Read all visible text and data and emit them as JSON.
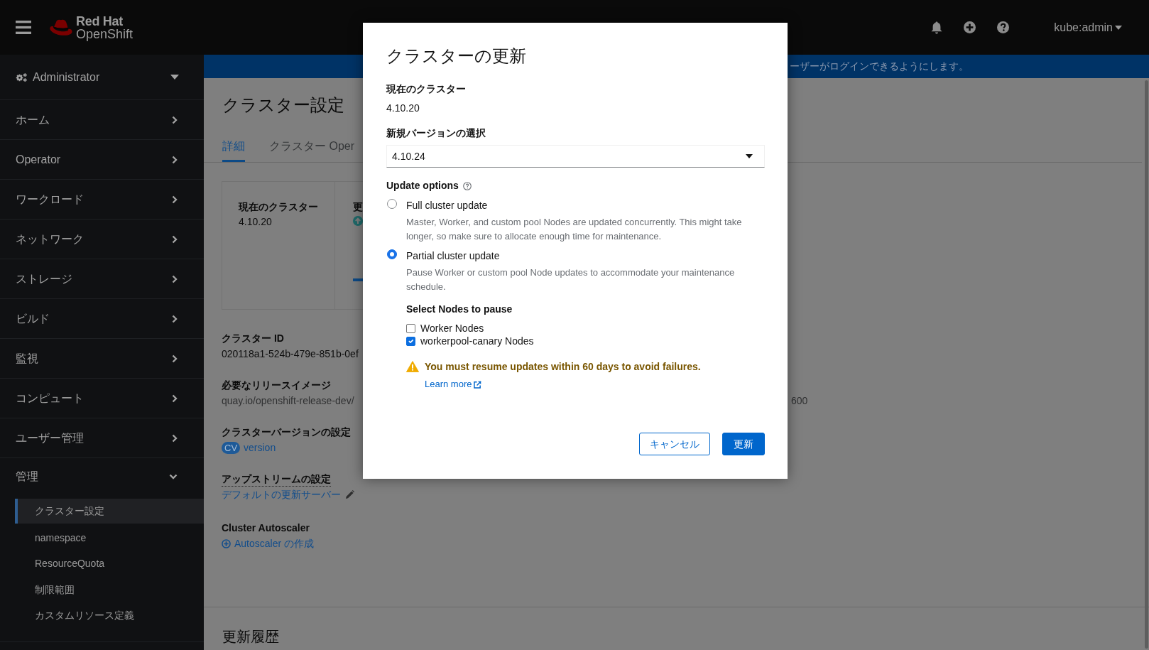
{
  "masthead": {
    "logo_top": "Red Hat",
    "logo_bottom": "OpenShift",
    "user": "kube:admin"
  },
  "sidebar": {
    "perspective": "Administrator",
    "items": [
      {
        "label": "ホーム",
        "expanded": false
      },
      {
        "label": "Operator",
        "expanded": false
      },
      {
        "label": "ワークロード",
        "expanded": false
      },
      {
        "label": "ネットワーク",
        "expanded": false
      },
      {
        "label": "ストレージ",
        "expanded": false
      },
      {
        "label": "ビルド",
        "expanded": false
      },
      {
        "label": "監視",
        "expanded": false
      },
      {
        "label": "コンピュート",
        "expanded": false
      },
      {
        "label": "ユーザー管理",
        "expanded": false
      },
      {
        "label": "管理",
        "expanded": true,
        "children": [
          {
            "label": "クラスター設定",
            "selected": true
          },
          {
            "label": "namespace",
            "selected": false
          },
          {
            "label": "ResourceQuota",
            "selected": false
          },
          {
            "label": "制限範囲",
            "selected": false
          },
          {
            "label": "カスタムリソース定義",
            "selected": false
          }
        ]
      }
    ]
  },
  "banner": {
    "text": "ーザーがログインできるようにします。"
  },
  "page": {
    "title": "クラスター設定",
    "tabs": [
      {
        "label": "詳細",
        "selected": true
      },
      {
        "label": "クラスター Oper",
        "selected": false
      }
    ],
    "summary_card": {
      "current_label": "現在のクラスター",
      "current_value": "4.10.20",
      "column_2_label": "更"
    },
    "details": [
      {
        "kind": "text",
        "label": "クラスター ID",
        "value": "020118a1-524b-479e-851b-0ef"
      },
      {
        "kind": "split_text",
        "label": "必要なリリースイメージ",
        "value": "quay.io/openshift-release-dev/",
        "value_tail": "600"
      },
      {
        "kind": "resource_link",
        "label": "クラスターバージョンの設定",
        "badge": "CV",
        "value": "version"
      },
      {
        "kind": "edit_link",
        "label": "アップストリームの設定",
        "value": "デフォルトの更新サーバー"
      },
      {
        "kind": "create_link",
        "label": "Cluster Autoscaler",
        "value": "Autoscaler の作成"
      }
    ],
    "history_title": "更新履歴"
  },
  "modal": {
    "title": "クラスターの更新",
    "current_label": "現在のクラスター",
    "current_value": "4.10.20",
    "version_label": "新規バージョンの選択",
    "version_value": "4.10.24",
    "options_label": "Update options",
    "options": [
      {
        "label": "Full cluster update",
        "description": "Master, Worker, and custom pool Nodes are updated concurrently. This might take longer, so make sure to allocate enough time for maintenance.",
        "selected": false
      },
      {
        "label": "Partial cluster update",
        "description": "Pause Worker or custom pool Node updates to accommodate your maintenance schedule.",
        "selected": true
      }
    ],
    "pause_label": "Select Nodes to pause",
    "pause_nodes": [
      {
        "label": "Worker Nodes",
        "checked": false
      },
      {
        "label": "workerpool-canary Nodes",
        "checked": true
      }
    ],
    "warning": {
      "text": "You must resume updates within 60 days to avoid failures.",
      "link": "Learn more"
    },
    "buttons": [
      {
        "label": "キャンセル",
        "kind": "secondary"
      },
      {
        "label": "更新",
        "kind": "primary"
      }
    ]
  }
}
